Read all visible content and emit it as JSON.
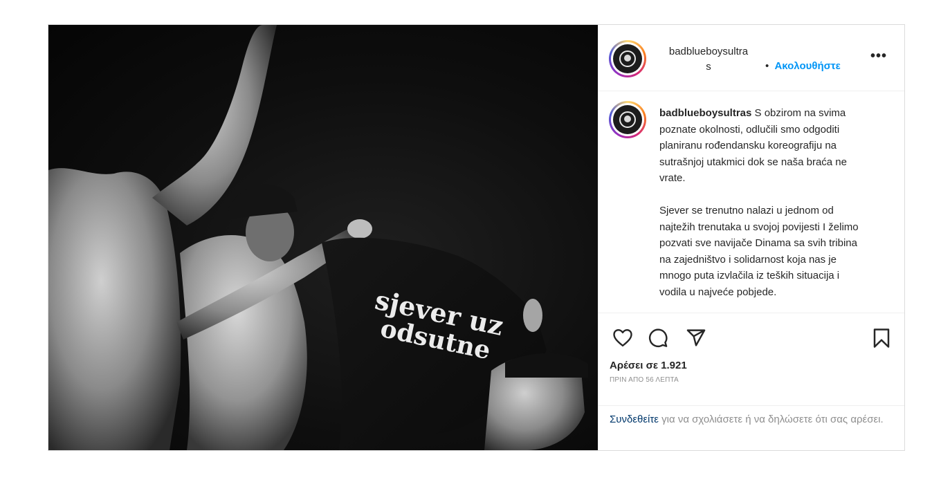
{
  "header": {
    "username_line1": "badblueboysultra",
    "username_line2": "s",
    "separator": "•",
    "follow_label": "Ακολουθήστε",
    "more_label": "•••"
  },
  "caption": {
    "username": "badblueboysultras",
    "paragraph1": "S obzirom na svima poznate okolnosti, odlučili smo odgoditi planiranu rođendansku koreografiju na sutrašnjoj utakmici dok se naša braća ne vrate.",
    "paragraph2": "Sjever se trenutno nalazi u jednom od najtežih trenutaka u svojoj povijesti I želimo pozvati sve navijače Dinama sa svih tribina na zajedništvo i solidarnost koja nas je mnogo puta izvlačila iz teških situacija i vodila u najveće pobjede."
  },
  "image": {
    "shirt_text_line1": "sjever uz",
    "shirt_text_line2": "odsutne"
  },
  "actions": {
    "like_icon": "heart-icon",
    "comment_icon": "comment-icon",
    "share_icon": "send-icon",
    "save_icon": "bookmark-icon"
  },
  "likes": {
    "count_label": "Αρέσει σε 1.921",
    "time_label": "ΠΡΙΝ ΑΠΟ 56 ΛΕΠΤΑ"
  },
  "login": {
    "link_label": "Συνδεθείτε",
    "rest_text": " για να σχολιάσετε ή να δηλώσετε ότι σας αρέσει."
  },
  "colors": {
    "follow_blue": "#0095f6",
    "link_dark_blue": "#00376b",
    "muted_gray": "#8e8e8e",
    "border": "#dbdbdb"
  }
}
